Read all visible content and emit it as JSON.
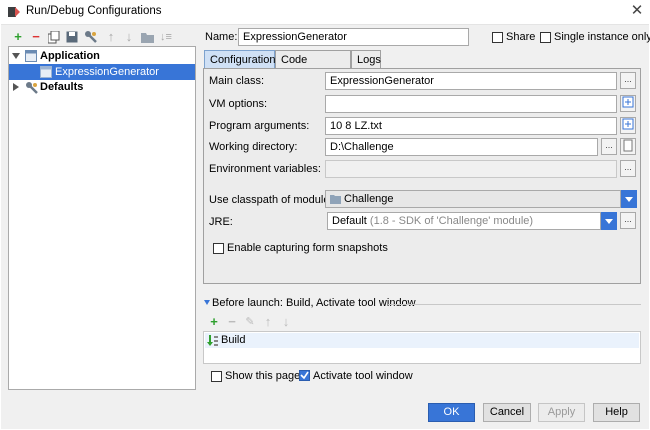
{
  "window": {
    "title": "Run/Debug Configurations"
  },
  "toolbar": {
    "icons": [
      "add-icon",
      "remove-icon",
      "copy-icon",
      "save-icon",
      "wrench-icon",
      "up-icon",
      "down-icon",
      "folder-icon",
      "sort-icon"
    ]
  },
  "tree": {
    "application": "Application",
    "config": "ExpressionGenerator",
    "defaults": "Defaults"
  },
  "header": {
    "name_label": "Name:",
    "name_value": "ExpressionGenerator",
    "share_label": "Share",
    "single_instance_label": "Single instance only"
  },
  "tabs": [
    "Configuration",
    "Code Coverage",
    "Logs"
  ],
  "form": {
    "main_class_label": "Main class:",
    "main_class_value": "ExpressionGenerator",
    "vm_options_label": "VM options:",
    "vm_options_value": "",
    "program_args_label": "Program arguments:",
    "program_args_value": "10 8 LZ.txt",
    "working_dir_label": "Working directory:",
    "working_dir_value": "D:\\Challenge",
    "env_vars_label": "Environment variables:",
    "env_vars_value": "",
    "classpath_label": "Use classpath of module:",
    "classpath_value": "Challenge",
    "jre_label": "JRE:",
    "jre_value_main": "Default",
    "jre_value_detail": "(1.8 - SDK of 'Challenge' module)",
    "snapshots_label": "Enable capturing form snapshots",
    "ellipsis": "..."
  },
  "before_launch": {
    "title": "Before launch: Build, Activate tool window",
    "item": "Build",
    "show_page_label": "Show this page",
    "activate_label": "Activate tool window"
  },
  "buttons": {
    "ok": "OK",
    "cancel": "Cancel",
    "apply": "Apply",
    "help": "Help"
  },
  "colors": {
    "selection": "#3875d7",
    "panel": "#ececec",
    "tab_active": "#cfe0f5"
  }
}
